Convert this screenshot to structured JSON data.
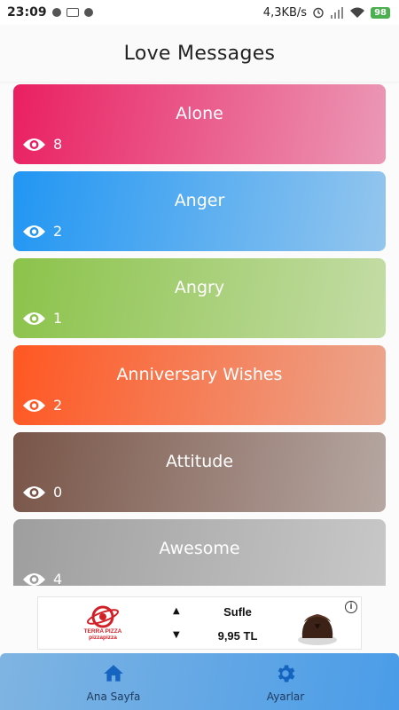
{
  "status_bar": {
    "time": "23:09",
    "network_speed": "4,3KB/s",
    "battery": "98"
  },
  "header": {
    "title": "Love Messages"
  },
  "categories": [
    {
      "title": "Alone",
      "views": "8",
      "gradient_start": "#ea1f62",
      "gradient_end": "#eb99b6"
    },
    {
      "title": "Anger",
      "views": "2",
      "gradient_start": "#2196f3",
      "gradient_end": "#94c6ee"
    },
    {
      "title": "Angry",
      "views": "1",
      "gradient_start": "#8bc34a",
      "gradient_end": "#c4dca6"
    },
    {
      "title": "Anniversary Wishes",
      "views": "2",
      "gradient_start": "#ff5722",
      "gradient_end": "#eba68e"
    },
    {
      "title": "Attitude",
      "views": "0",
      "gradient_start": "#795548",
      "gradient_end": "#b6a7a2"
    },
    {
      "title": "Awesome",
      "views": "4",
      "gradient_start": "#9e9e9e",
      "gradient_end": "#c8c8c8"
    }
  ],
  "ad": {
    "brand": "TERRA PIZZA",
    "brand_sub": "pizzapizza",
    "product_name": "Sufle",
    "price": "9,95 TL",
    "info_icon": "info-icon"
  },
  "bottom_nav": {
    "items": [
      {
        "label": "Ana Sayfa",
        "icon": "home-icon"
      },
      {
        "label": "Ayarlar",
        "icon": "gear-icon"
      }
    ]
  },
  "colors": {
    "nav_gradient_start": "#7fb4e2",
    "nav_gradient_end": "#4a9ce8",
    "nav_icon": "#1565c0",
    "ad_brand": "#d32027"
  }
}
